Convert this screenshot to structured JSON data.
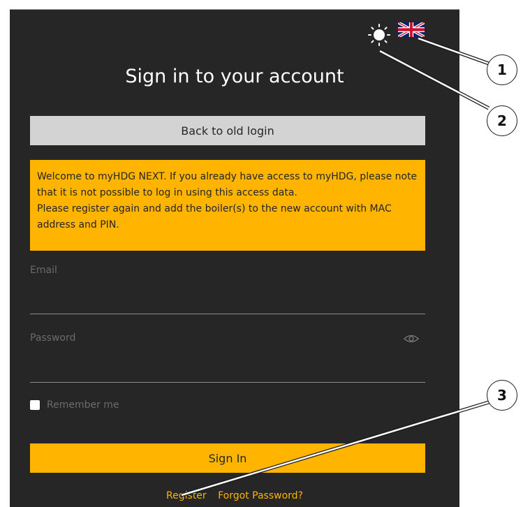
{
  "header": {
    "theme_icon": "sun-icon",
    "language_icon": "uk-flag-icon",
    "title": "Sign in to your account"
  },
  "back_button": {
    "label": "Back to old login"
  },
  "notice": {
    "line1": "Welcome to myHDG NEXT. If you already have access to myHDG, please note that it is not possible to log in using this access data.",
    "line2": "Please register again and add the boiler(s) to the new account with MAC address and PIN."
  },
  "form": {
    "email_label": "Email",
    "email_value": "",
    "password_label": "Password",
    "password_value": "",
    "password_toggle_icon": "eye-icon",
    "remember_label": "Remember me",
    "sign_in_label": "Sign In"
  },
  "links": {
    "register": "Register",
    "forgot": "Forgot Password?"
  },
  "callouts": [
    "1",
    "2",
    "3"
  ],
  "colors": {
    "panel": "#262626",
    "accent": "#ffb400",
    "secondary_button": "#d3d3d3"
  }
}
